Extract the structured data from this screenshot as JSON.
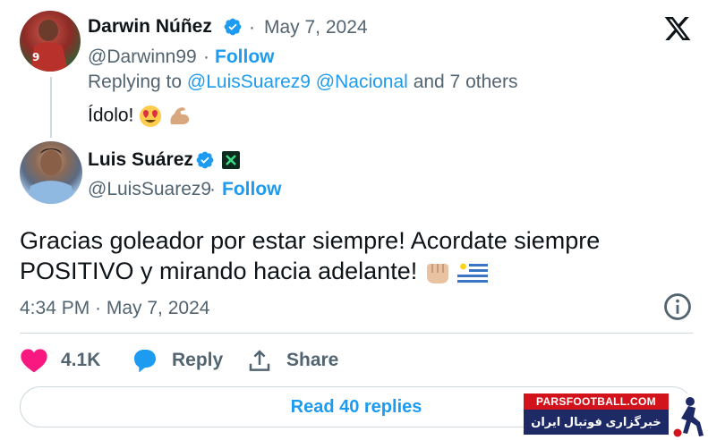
{
  "brand": {
    "accent": "#1d9bf0",
    "text": "#0f1419",
    "muted": "#536471",
    "like": "#f91880"
  },
  "reply_tweet": {
    "author_name": "Darwin Núñez",
    "handle": "@Darwinn99",
    "separator": "·",
    "date": "May 7, 2024",
    "follow_label": "Follow",
    "replying_prefix": "Replying to",
    "replying_mentions": "@LuisSuarez9 @Nacional",
    "replying_suffix": "and 7 others",
    "text": "Ídolo!",
    "emojis": [
      "heart-eyes-emoji",
      "flexed-biceps-emoji"
    ]
  },
  "main_tweet": {
    "author_name": "Luis Suárez",
    "handle": "@LuisSuarez9",
    "separator": "·",
    "follow_label": "Follow",
    "text": "Gracias goleador por estar siempre! Acordate siempre POSITIVO y mirando hacia adelante!",
    "emojis": [
      "fist-emoji",
      "uruguay-flag-emoji"
    ],
    "timestamp": "4:34 PM · May 7, 2024"
  },
  "actions": {
    "like_count": "4.1K",
    "reply_label": "Reply",
    "share_label": "Share"
  },
  "read_replies_label": "Read 40 replies",
  "watermark": {
    "site": "PARSFOOTBALL.COM",
    "tagline": "خبرگزاری فوتبال ایران"
  },
  "icons": [
    "x-logo-icon",
    "verified-badge-icon",
    "affiliate-badge-icon",
    "info-icon",
    "heart-icon",
    "reply-bubble-icon",
    "share-icon"
  ]
}
